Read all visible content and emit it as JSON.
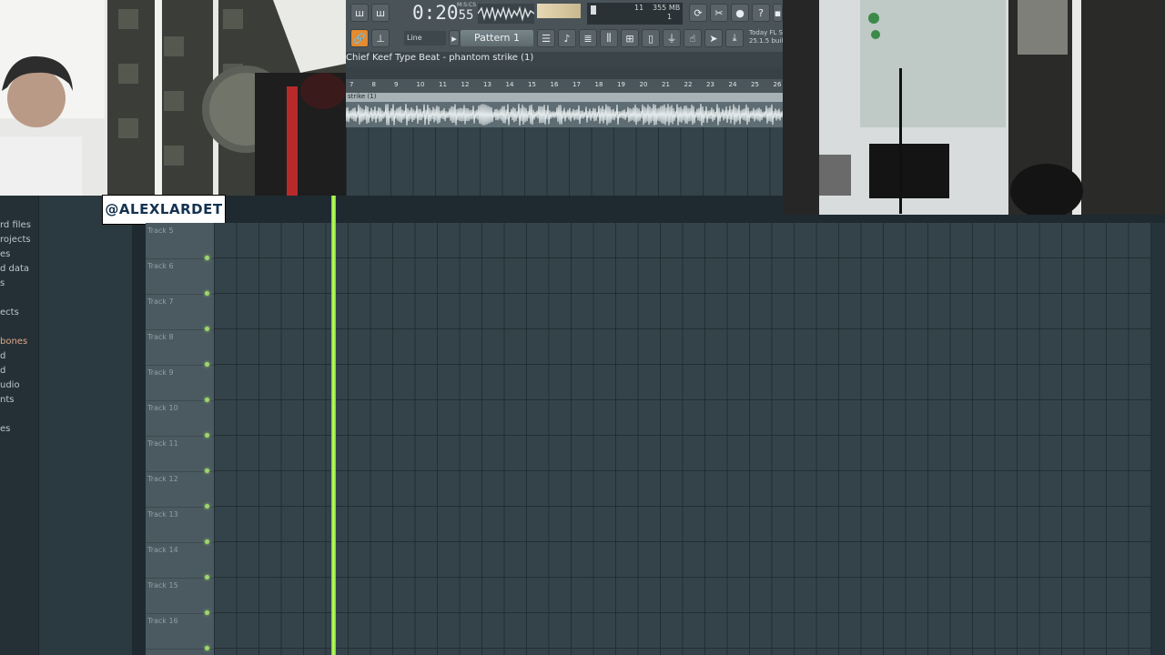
{
  "toolbar": {
    "time": "0:20",
    "time_small": "55",
    "time_unit": "M:S:CS",
    "cpu_value": "11",
    "memory": "355 MB",
    "voices": "1",
    "snap_label": "Line",
    "pattern_label": "Pattern 1",
    "news_line1": "Today  FL S",
    "news_line2": "25.1.5 buil"
  },
  "playlist": {
    "title": "Chief Keef Type Beat - phantom strike (1)",
    "clip_name": "strike (1)",
    "ticks": [
      "7",
      "8",
      "9",
      "10",
      "11",
      "12",
      "13",
      "14",
      "15",
      "16",
      "17",
      "18",
      "19",
      "20",
      "21",
      "22",
      "23",
      "24",
      "25",
      "26"
    ]
  },
  "browser": {
    "items": [
      {
        "label": "rd files"
      },
      {
        "label": "rojects"
      },
      {
        "label": "es"
      },
      {
        "label": "d data"
      },
      {
        "label": "s"
      },
      {
        "label": "ects"
      },
      {
        "label": "bones"
      },
      {
        "label": "d"
      },
      {
        "label": "d"
      },
      {
        "label": "udio"
      },
      {
        "label": "nts"
      },
      {
        "label": "es"
      }
    ]
  },
  "tracks": [
    "Track 5",
    "Track 6",
    "Track 7",
    "Track 8",
    "Track 9",
    "Track 10",
    "Track 11",
    "Track 12",
    "Track 13",
    "Track 14",
    "Track 15",
    "Track 16"
  ],
  "overlay": {
    "handle": "@ALEXLARDET"
  },
  "colors": {
    "playhead": "#8fe33a",
    "grid": "#34434a",
    "led": "#9ed66a"
  }
}
